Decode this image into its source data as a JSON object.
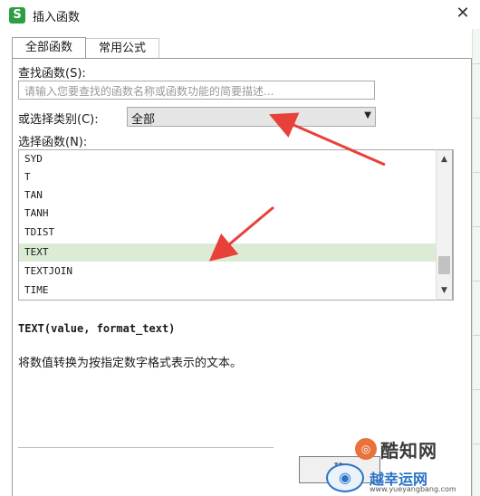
{
  "window": {
    "app_icon": "S",
    "title": "插入函数",
    "close_icon": "close-icon"
  },
  "tabs": [
    {
      "label": "全部函数",
      "active": true
    },
    {
      "label": "常用公式",
      "active": false
    }
  ],
  "search": {
    "label": "查找函数(S):",
    "placeholder": "请输入您要查找的函数名称或函数功能的简要描述..."
  },
  "category": {
    "label": "或选择类别(C):",
    "value": "全部"
  },
  "function_list": {
    "label": "选择函数(N):",
    "items": [
      "SYD",
      "T",
      "TAN",
      "TANH",
      "TDIST",
      "TEXT",
      "TEXTJOIN",
      "TIME"
    ],
    "selected": "TEXT"
  },
  "signature": "TEXT(value, format_text)",
  "description": "将数值转换为按指定数字格式表示的文本。",
  "ok_button": "确",
  "watermarks": {
    "brand1": "酷知网",
    "brand2": "越幸运网",
    "url": "www.yueyangbang.com"
  },
  "colors": {
    "selection": "#dcebd4",
    "annotation_arrow": "#e8413a",
    "app_icon": "#2e9e44"
  }
}
